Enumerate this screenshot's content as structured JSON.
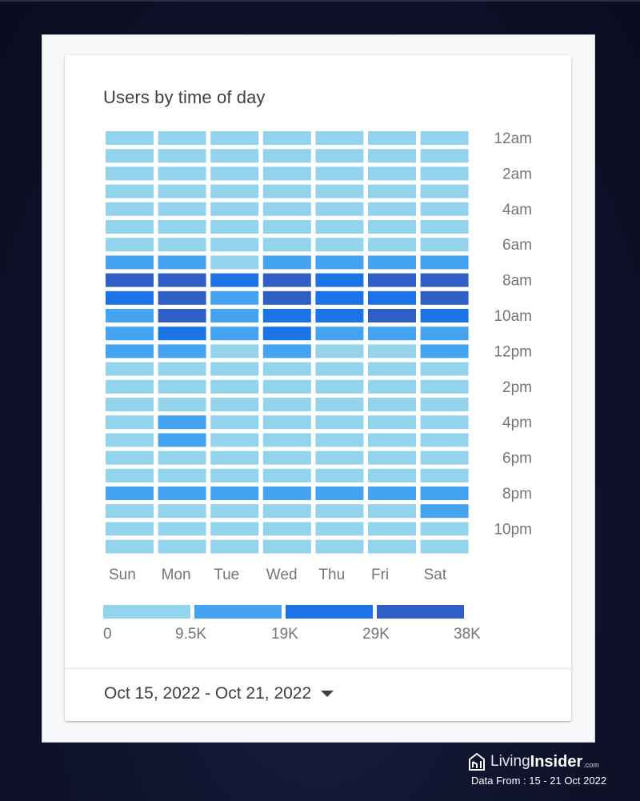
{
  "card": {
    "title": "Users by time of day",
    "date_range": "Oct 15, 2022 - Oct 21, 2022",
    "date_range_icon": "caret-down-icon"
  },
  "brand": {
    "name_part1": "Living",
    "name_part2": "Insider",
    "suffix": ".com",
    "note": "Data From : 15 - 21 Oct 2022",
    "icon": "house-logo-icon"
  },
  "chart_data": {
    "type": "heatmap",
    "title": "Users by time of day",
    "x": [
      "Sun",
      "Mon",
      "Tue",
      "Wed",
      "Thu",
      "Fri",
      "Sat"
    ],
    "y": [
      "12am",
      "1am",
      "2am",
      "3am",
      "4am",
      "5am",
      "6am",
      "7am",
      "8am",
      "9am",
      "10am",
      "11am",
      "12pm",
      "1pm",
      "2pm",
      "3pm",
      "4pm",
      "5pm",
      "6pm",
      "7pm",
      "8pm",
      "9pm",
      "10pm",
      "11pm"
    ],
    "y_tick_labels": [
      "12am",
      "2am",
      "4am",
      "6am",
      "8am",
      "10am",
      "12pm",
      "2pm",
      "4pm",
      "6pm",
      "8pm",
      "10pm"
    ],
    "value_unit": "users",
    "color_scale": {
      "colors": [
        "#93d4ec",
        "#45a4f2",
        "#1b73e6",
        "#2f5ec4"
      ],
      "bins": [
        [
          0,
          9500
        ],
        [
          9500,
          19000
        ],
        [
          19000,
          29000
        ],
        [
          29000,
          38000
        ]
      ],
      "tick_labels": [
        "0",
        "9.5K",
        "19K",
        "29K",
        "38K"
      ]
    },
    "bin_levels": [
      [
        0,
        0,
        0,
        0,
        0,
        0,
        0
      ],
      [
        0,
        0,
        0,
        0,
        0,
        0,
        0
      ],
      [
        0,
        0,
        0,
        0,
        0,
        0,
        0
      ],
      [
        0,
        0,
        0,
        0,
        0,
        0,
        0
      ],
      [
        0,
        0,
        0,
        0,
        0,
        0,
        0
      ],
      [
        0,
        0,
        0,
        0,
        0,
        0,
        0
      ],
      [
        0,
        0,
        0,
        0,
        0,
        0,
        0
      ],
      [
        1,
        1,
        0,
        1,
        1,
        1,
        1
      ],
      [
        3,
        3,
        2,
        3,
        2,
        3,
        3
      ],
      [
        2,
        3,
        1,
        3,
        2,
        2,
        3
      ],
      [
        1,
        3,
        1,
        2,
        2,
        3,
        2
      ],
      [
        1,
        2,
        1,
        2,
        1,
        1,
        1
      ],
      [
        1,
        1,
        0,
        1,
        0,
        0,
        1
      ],
      [
        0,
        0,
        0,
        0,
        0,
        0,
        0
      ],
      [
        0,
        0,
        0,
        0,
        0,
        0,
        0
      ],
      [
        0,
        0,
        0,
        0,
        0,
        0,
        0
      ],
      [
        0,
        1,
        0,
        0,
        0,
        0,
        0
      ],
      [
        0,
        1,
        0,
        0,
        0,
        0,
        0
      ],
      [
        0,
        0,
        0,
        0,
        0,
        0,
        0
      ],
      [
        0,
        0,
        0,
        0,
        0,
        0,
        0
      ],
      [
        1,
        1,
        1,
        1,
        1,
        1,
        1
      ],
      [
        0,
        0,
        0,
        0,
        0,
        0,
        1
      ],
      [
        0,
        0,
        0,
        0,
        0,
        0,
        0
      ],
      [
        0,
        0,
        0,
        0,
        0,
        0,
        0
      ]
    ],
    "values_estimated_bin_midpoint": [
      [
        4750,
        4750,
        4750,
        4750,
        4750,
        4750,
        4750
      ],
      [
        4750,
        4750,
        4750,
        4750,
        4750,
        4750,
        4750
      ],
      [
        4750,
        4750,
        4750,
        4750,
        4750,
        4750,
        4750
      ],
      [
        4750,
        4750,
        4750,
        4750,
        4750,
        4750,
        4750
      ],
      [
        4750,
        4750,
        4750,
        4750,
        4750,
        4750,
        4750
      ],
      [
        4750,
        4750,
        4750,
        4750,
        4750,
        4750,
        4750
      ],
      [
        4750,
        4750,
        4750,
        4750,
        4750,
        4750,
        4750
      ],
      [
        14250,
        14250,
        4750,
        14250,
        14250,
        14250,
        14250
      ],
      [
        33500,
        33500,
        24000,
        33500,
        24000,
        33500,
        33500
      ],
      [
        24000,
        33500,
        14250,
        33500,
        24000,
        24000,
        33500
      ],
      [
        14250,
        33500,
        14250,
        24000,
        24000,
        33500,
        24000
      ],
      [
        14250,
        24000,
        14250,
        24000,
        14250,
        14250,
        14250
      ],
      [
        14250,
        14250,
        4750,
        14250,
        4750,
        4750,
        14250
      ],
      [
        4750,
        4750,
        4750,
        4750,
        4750,
        4750,
        4750
      ],
      [
        4750,
        4750,
        4750,
        4750,
        4750,
        4750,
        4750
      ],
      [
        4750,
        4750,
        4750,
        4750,
        4750,
        4750,
        4750
      ],
      [
        4750,
        14250,
        4750,
        4750,
        4750,
        4750,
        4750
      ],
      [
        4750,
        14250,
        4750,
        4750,
        4750,
        4750,
        4750
      ],
      [
        4750,
        4750,
        4750,
        4750,
        4750,
        4750,
        4750
      ],
      [
        4750,
        4750,
        4750,
        4750,
        4750,
        4750,
        4750
      ],
      [
        14250,
        14250,
        14250,
        14250,
        14250,
        14250,
        14250
      ],
      [
        4750,
        4750,
        4750,
        4750,
        4750,
        4750,
        14250
      ],
      [
        4750,
        4750,
        4750,
        4750,
        4750,
        4750,
        4750
      ],
      [
        4750,
        4750,
        4750,
        4750,
        4750,
        4750,
        4750
      ]
    ],
    "xlabel": "",
    "ylabel": "",
    "legend": "bottom",
    "grid": false
  }
}
